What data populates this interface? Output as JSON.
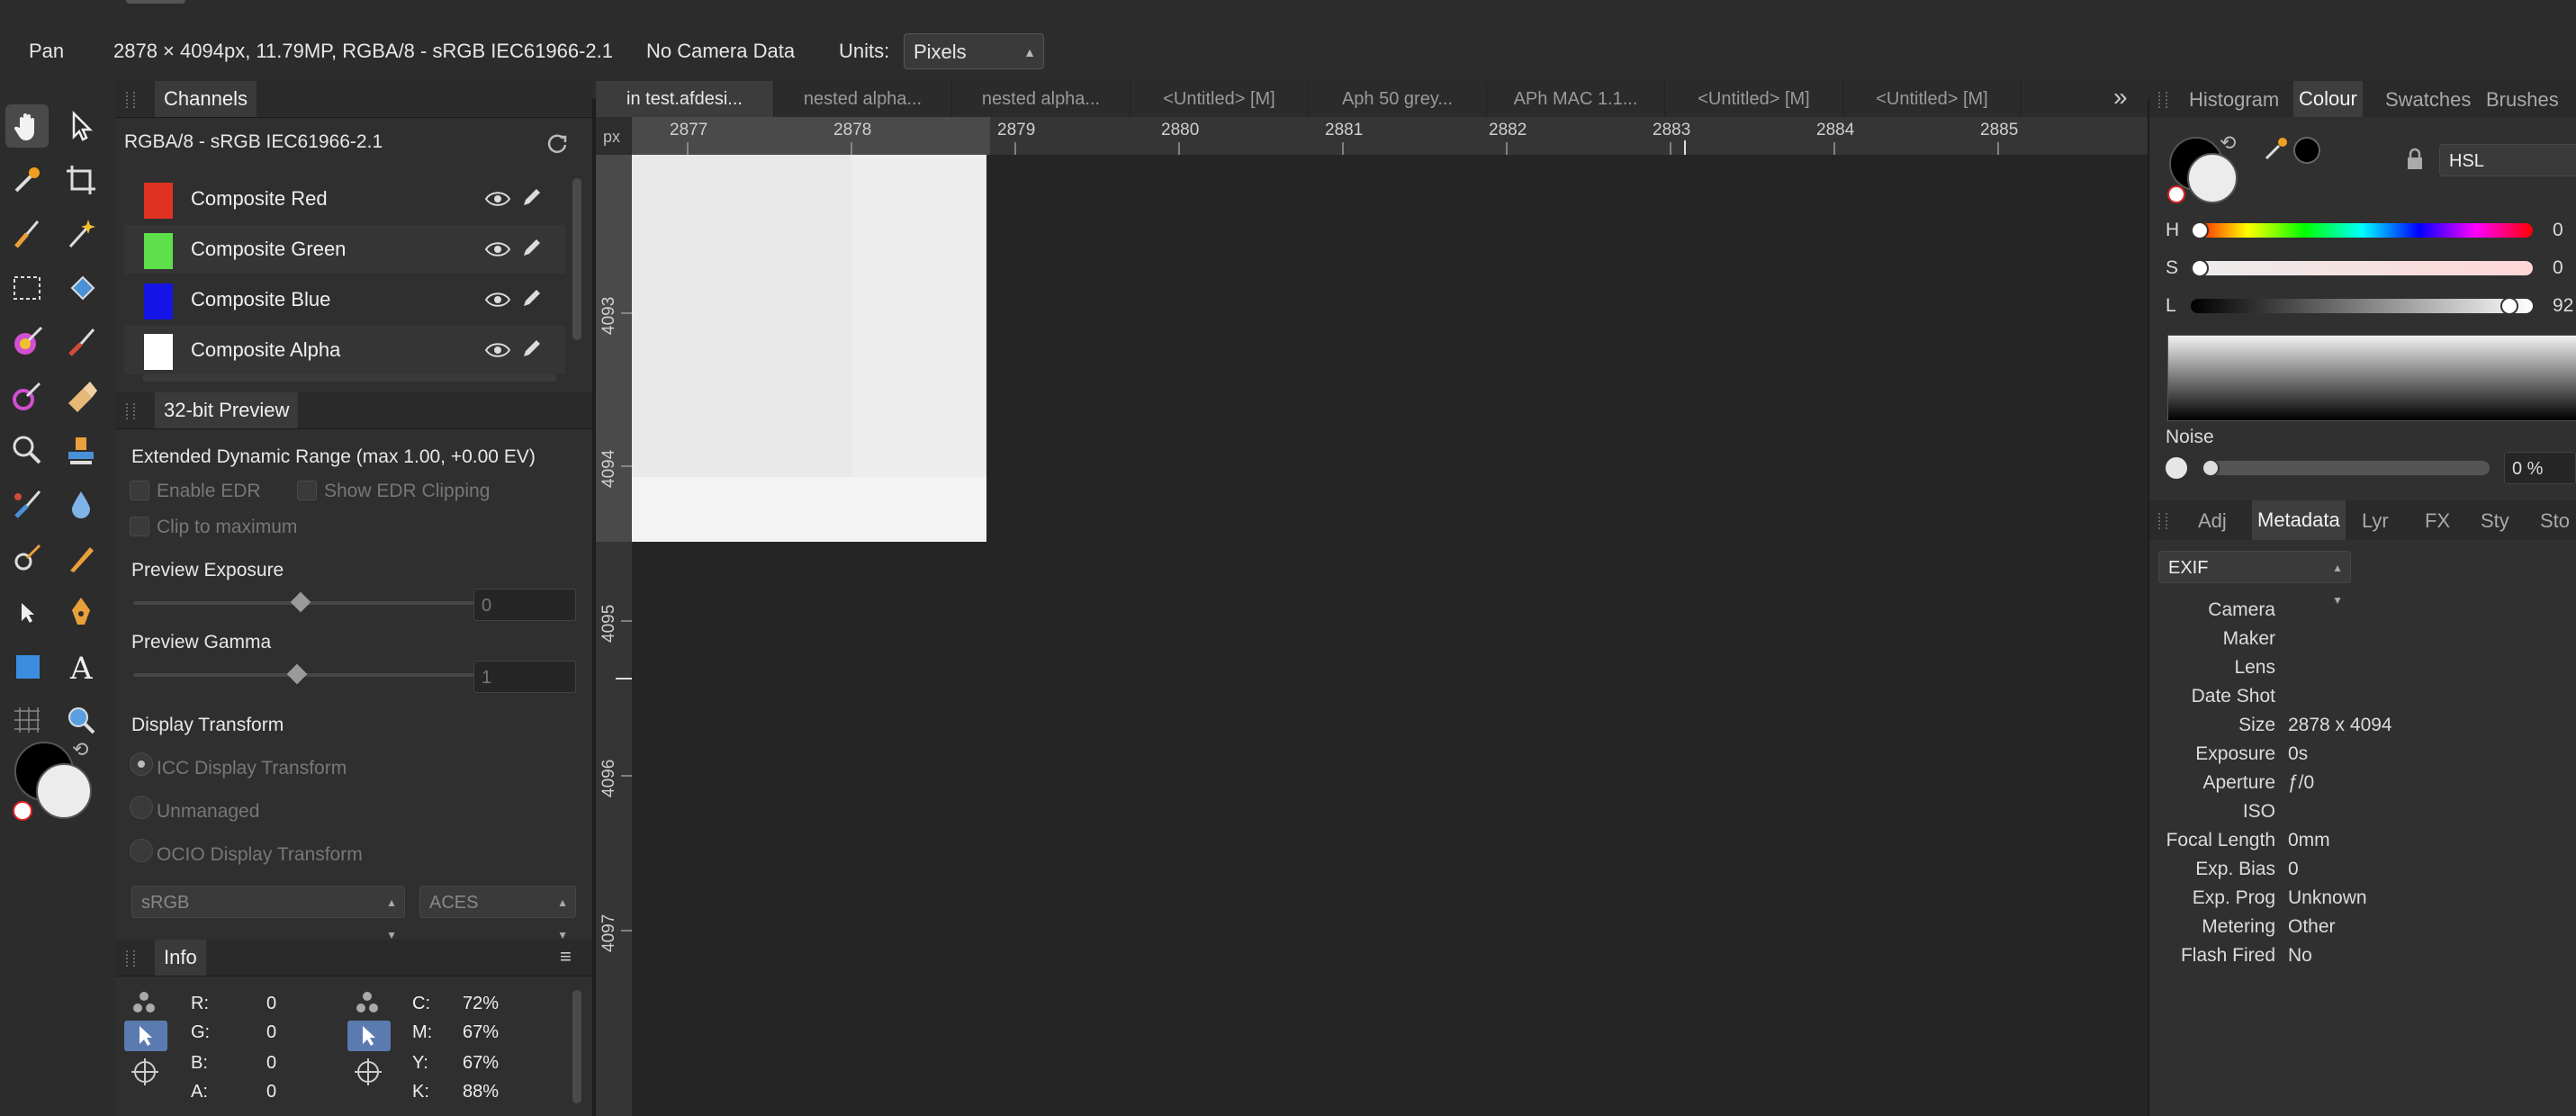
{
  "context_toolbar": {
    "tool_name": "Pan",
    "doc_info": "2878 × 4094px, 11.79MP, RGBA/8 - sRGB IEC61966-2.1",
    "camera": "No Camera Data",
    "units_label": "Units:",
    "units_value": "Pixels"
  },
  "tools": [
    "hand-icon",
    "move-arrow-icon",
    "color-picker-icon",
    "crop-icon",
    "paint-brush-icon",
    "magic-wand-icon",
    "marquee-select-icon",
    "flood-fill-icon",
    "color-wheel-brush-icon",
    "paint-brush-2-icon",
    "selection-brush-icon",
    "eraser-icon",
    "dodge-icon",
    "clone-stamp-icon",
    "retouch-brush-icon",
    "blur-drop-icon",
    "smudge-icon",
    "pen-brush-icon",
    "node-pointer-icon",
    "pen-tool-icon",
    "rectangle-icon",
    "text-icon",
    "mesh-warp-icon",
    "zoom-icon"
  ],
  "channels": {
    "title": "Channels",
    "profile": "RGBA/8 - sRGB IEC61966-2.1",
    "items": [
      {
        "label": "Composite Red",
        "color": "#e03221"
      },
      {
        "label": "Composite Green",
        "color": "#5ee04a"
      },
      {
        "label": "Composite Blue",
        "color": "#1414e6"
      },
      {
        "label": "Composite Alpha",
        "color": "#ffffff"
      }
    ]
  },
  "preview32": {
    "title": "32-bit Preview",
    "edr_heading": "Extended Dynamic Range (max 1.00, +0.00 EV)",
    "enable_edr": "Enable EDR",
    "show_edr_clipping": "Show EDR Clipping",
    "clip_to_max": "Clip to maximum",
    "exposure_label": "Preview Exposure",
    "exposure_value": "0",
    "gamma_label": "Preview Gamma",
    "gamma_value": "1",
    "display_transform_label": "Display Transform",
    "icc": "ICC Display Transform",
    "unmanaged": "Unmanaged",
    "ocio": "OCIO Display Transform",
    "ocio_space": "sRGB",
    "ocio_look": "ACES"
  },
  "info": {
    "title": "Info",
    "rgba": [
      [
        "R:",
        "0"
      ],
      [
        "G:",
        "0"
      ],
      [
        "B:",
        "0"
      ],
      [
        "A:",
        "0"
      ]
    ],
    "cmyk": [
      [
        "C:",
        "72%"
      ],
      [
        "M:",
        "67%"
      ],
      [
        "Y:",
        "67%"
      ],
      [
        "K:",
        "88%"
      ]
    ]
  },
  "doc_tabs": [
    "in test.afdesi...",
    "nested alpha...",
    "nested alpha...",
    "<Untitled> [M]",
    "Aph 50 grey...",
    "APh MAC 1.1...",
    "<Untitled> [M]",
    "<Untitled> [M]"
  ],
  "ruler": {
    "unit": "px",
    "h_labels": [
      "2877",
      "2878",
      "2879",
      "2880",
      "2881",
      "2882",
      "2883",
      "2884",
      "2885"
    ],
    "v_labels": [
      "4093",
      "4094",
      "4095",
      "4096",
      "4097"
    ]
  },
  "right_tabs_top": [
    "Histogram",
    "Colour",
    "Swatches",
    "Brushes"
  ],
  "colour": {
    "model": "HSL",
    "h_label": "H",
    "h_value": "0",
    "s_label": "S",
    "s_value": "0",
    "l_label": "L",
    "l_value": "92",
    "noise_label": "Noise",
    "noise_value": "0 %"
  },
  "right_tabs_bottom": [
    "Adj",
    "Metadata",
    "Lyr",
    "FX",
    "Sty",
    "Sto"
  ],
  "metadata": {
    "section": "EXIF",
    "rows": [
      {
        "k": "Camera",
        "v": ""
      },
      {
        "k": "Maker",
        "v": ""
      },
      {
        "k": "Lens",
        "v": ""
      },
      {
        "k": "Date Shot",
        "v": ""
      },
      {
        "k": "Size",
        "v": "2878 x 4094"
      },
      {
        "k": "Exposure",
        "v": "0s"
      },
      {
        "k": "Aperture",
        "v": "ƒ/0"
      },
      {
        "k": "ISO",
        "v": ""
      },
      {
        "k": "Focal Length",
        "v": "0mm"
      },
      {
        "k": "Exp. Bias",
        "v": "0"
      },
      {
        "k": "Exp. Prog",
        "v": "Unknown"
      },
      {
        "k": "Metering",
        "v": "Other"
      },
      {
        "k": "Flash Fired",
        "v": "No"
      }
    ]
  }
}
